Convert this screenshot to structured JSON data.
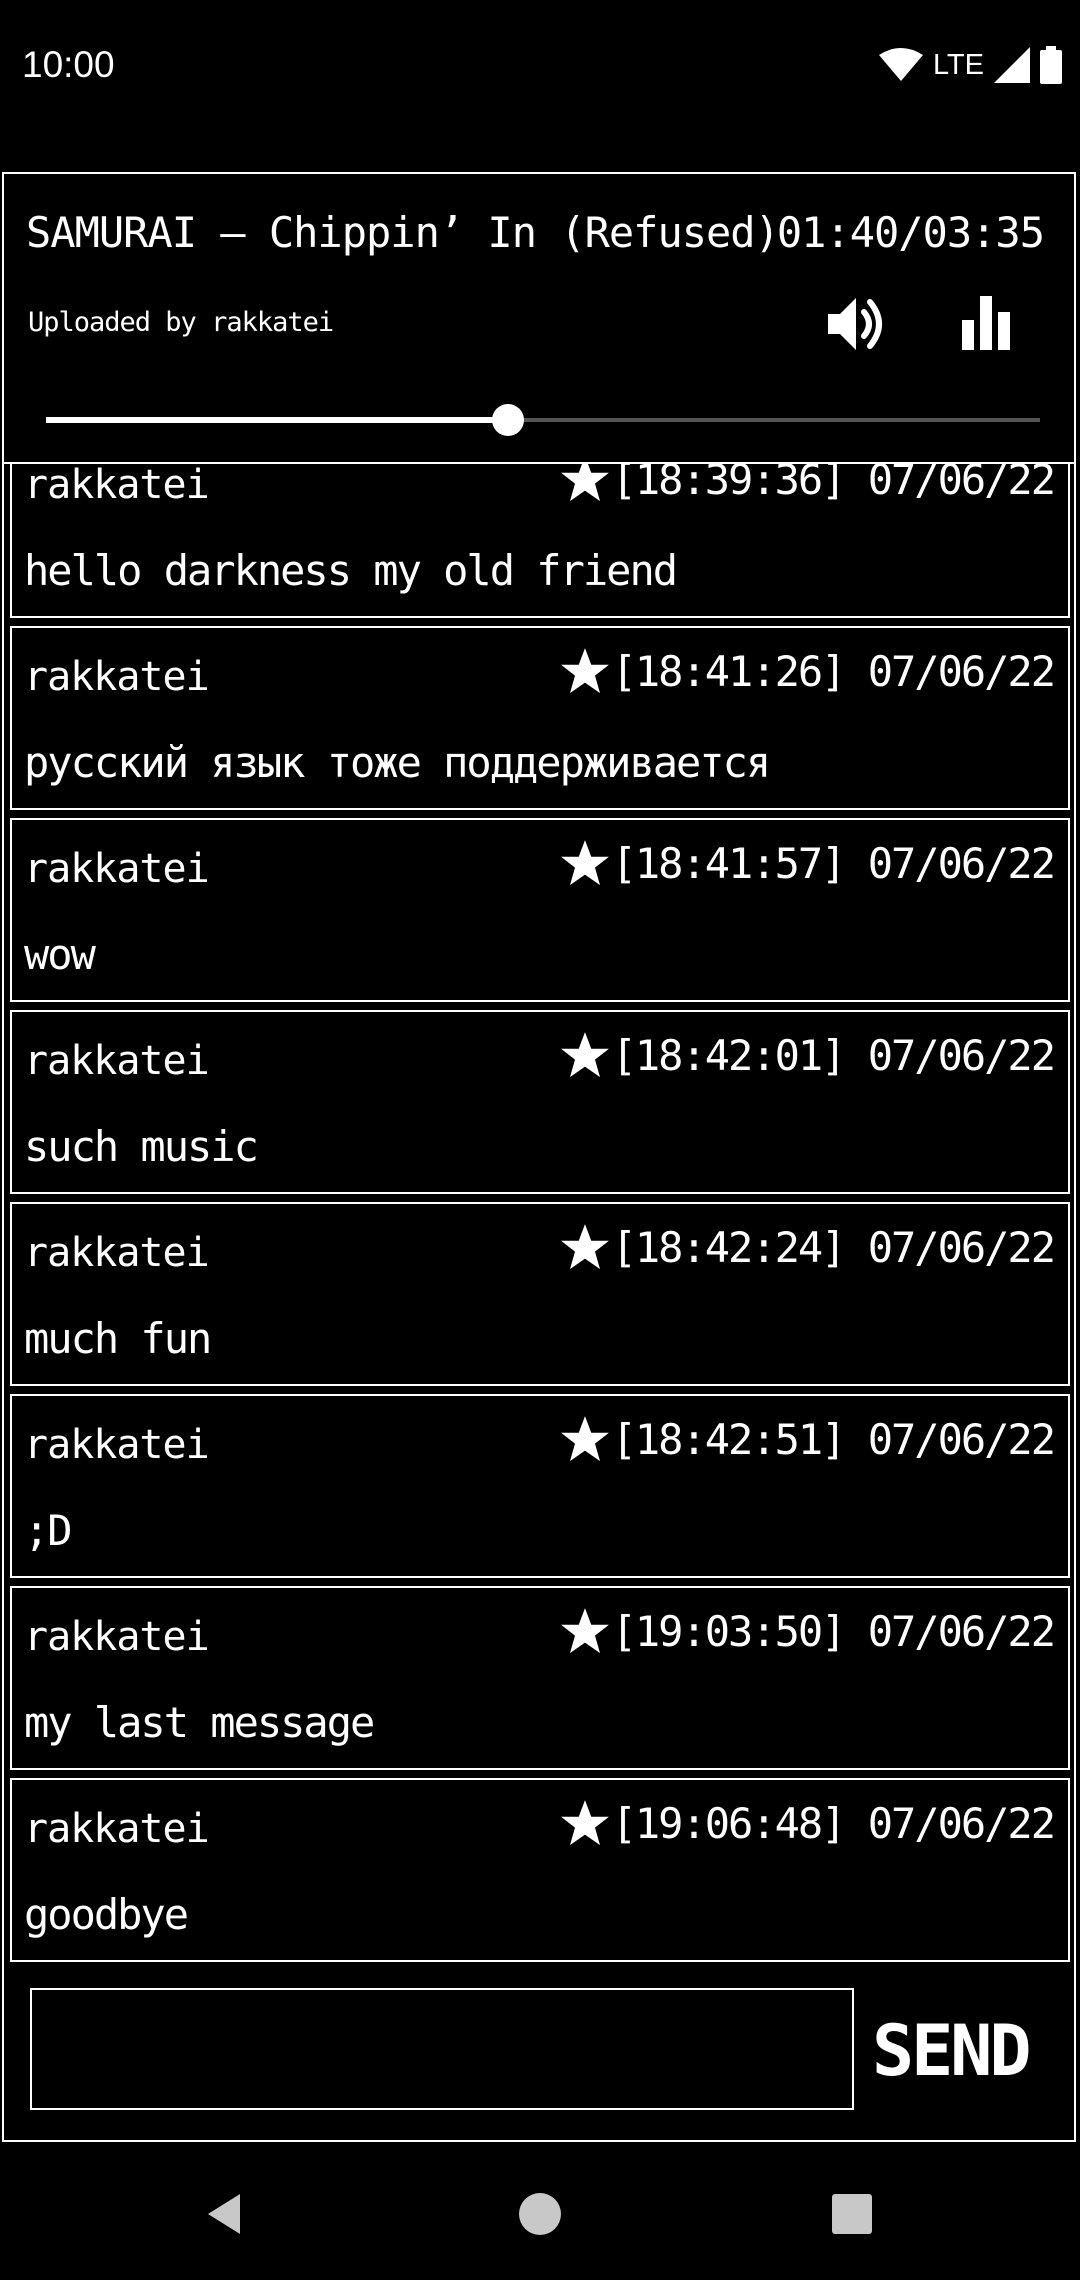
{
  "status_bar": {
    "time": "10:00",
    "network": "LTE",
    "icons": [
      "wifi-icon",
      "signal-icon",
      "battery-icon"
    ]
  },
  "player": {
    "title": "SAMURAI – Chippin’ In (Refused)",
    "time": "01:40/03:35",
    "uploader": "Uploaded by rakkatei",
    "progress": 0.465,
    "icons": [
      "volume-icon",
      "equalizer-icon"
    ]
  },
  "messages": [
    {
      "user": "rakkatei",
      "time": "[18:39:36] 07/06/22",
      "text": "hello darkness my old friend"
    },
    {
      "user": "rakkatei",
      "time": "[18:41:26] 07/06/22",
      "text": "русский язык тоже поддерживается"
    },
    {
      "user": "rakkatei",
      "time": "[18:41:57] 07/06/22",
      "text": "wow"
    },
    {
      "user": "rakkatei",
      "time": "[18:42:01] 07/06/22",
      "text": "such music"
    },
    {
      "user": "rakkatei",
      "time": "[18:42:24] 07/06/22",
      "text": "much fun"
    },
    {
      "user": "rakkatei",
      "time": "[18:42:51] 07/06/22",
      "text": ";D"
    },
    {
      "user": "rakkatei",
      "time": "[19:03:50] 07/06/22",
      "text": "my last message"
    },
    {
      "user": "rakkatei",
      "time": "[19:06:48] 07/06/22",
      "text": "goodbye"
    }
  ],
  "composer": {
    "input_value": "",
    "send_label": "SEND"
  },
  "nav_bar": {
    "icons": [
      "back-icon",
      "home-icon",
      "recents-icon"
    ]
  },
  "colors": {
    "background": "#000000",
    "foreground": "#ffffff",
    "seek_track": "#555555"
  }
}
